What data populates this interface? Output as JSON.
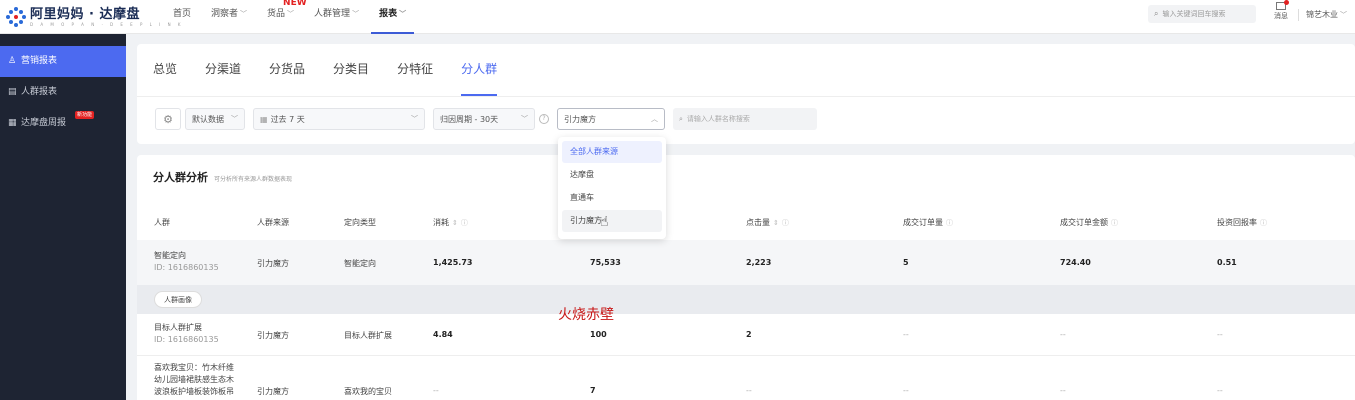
{
  "header": {
    "logo_title": "阿里妈妈 · 达摩盘",
    "logo_sub": "D A M O P A N · D E E P L I N K",
    "nav": [
      {
        "label": "首页",
        "chevron": false
      },
      {
        "label": "洞察者",
        "chevron": true
      },
      {
        "label": "货品",
        "chevron": true,
        "badge": "NEW"
      },
      {
        "label": "人群管理",
        "chevron": true
      },
      {
        "label": "报表",
        "chevron": true,
        "active": true
      }
    ],
    "search_placeholder": "输入关键词回车搜索",
    "message_label": "消息",
    "user_name": "锦艺木业"
  },
  "sidebar": {
    "items": [
      {
        "label": "营销报表",
        "icon": "user-icon",
        "active": true
      },
      {
        "label": "人群报表",
        "icon": "report-icon"
      },
      {
        "label": "达摩盘周报",
        "icon": "calendar-icon",
        "badge": "新功能"
      }
    ]
  },
  "tabs": [
    {
      "label": "总览"
    },
    {
      "label": "分渠道"
    },
    {
      "label": "分货品"
    },
    {
      "label": "分类目"
    },
    {
      "label": "分特征"
    },
    {
      "label": "分人群",
      "active": true
    }
  ],
  "filters": {
    "data_select": "默认数据",
    "date_select": "过去 7 天",
    "period_select": "归因周期 - 30天",
    "source_select": "引力魔方",
    "search_placeholder": "请输入人群名称搜索"
  },
  "dropdown": {
    "options": [
      {
        "label": "全部人群来源",
        "state": "selected"
      },
      {
        "label": "达摩盘",
        "state": ""
      },
      {
        "label": "直通车",
        "state": ""
      },
      {
        "label": "引力魔方",
        "state": "hover"
      }
    ]
  },
  "table": {
    "title": "分人群分析",
    "subtitle": "可分析所有来源人群数据表现",
    "headers": [
      "人群",
      "人群来源",
      "定向类型",
      "消耗",
      "",
      "点击量",
      "成交订单量",
      "成交订单金额",
      "投资回报率"
    ],
    "rows": [
      {
        "name": "智能定向",
        "id": "ID: 1616860135",
        "source": "引力魔方",
        "type": "智能定向",
        "cost": "1,425.73",
        "impressions": "75,533",
        "clicks": "2,223",
        "orders": "5",
        "amount": "724.40",
        "roi": "0.51"
      },
      {
        "name": "目标人群扩展",
        "id": "ID: 1616860135",
        "source": "引力魔方",
        "type": "目标人群扩展",
        "cost": "4.84",
        "impressions": "100",
        "clicks": "2",
        "orders": "--",
        "amount": "--",
        "roi": "--"
      },
      {
        "name": "喜欢我宝贝：竹木纤维",
        "name2": "幼儿园墙裙肤感生态木",
        "name3": "波浪板护墙板装饰板吊",
        "source": "引力魔方",
        "type": "喜欢我的宝贝",
        "cost": "--",
        "impressions": "7",
        "clicks": "--",
        "orders": "--",
        "amount": "--",
        "roi": "--"
      }
    ],
    "tag_label": "人群画像"
  },
  "overlay_text": "火烧赤壁"
}
